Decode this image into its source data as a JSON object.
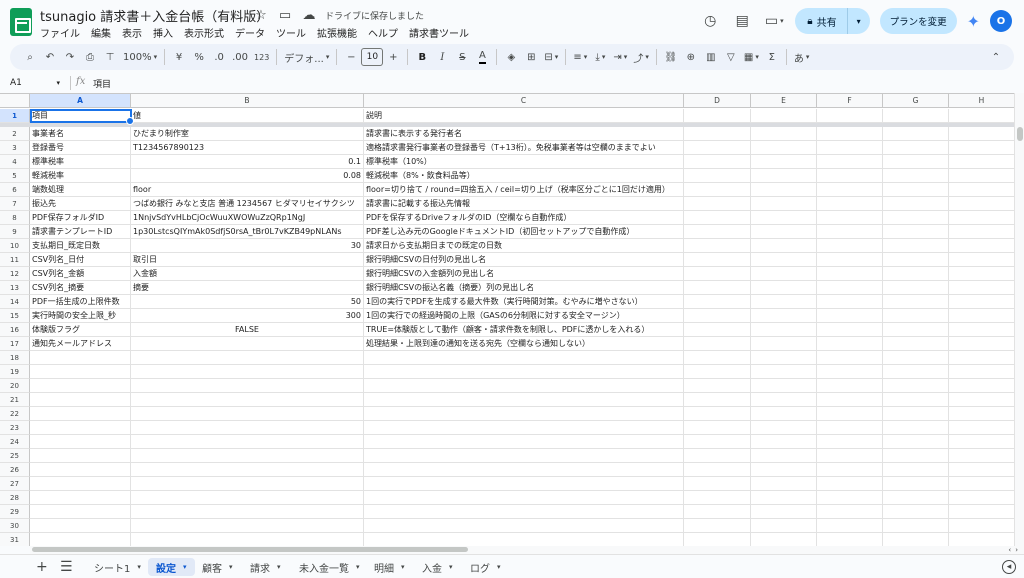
{
  "header": {
    "doc_title": "tsunagio 請求書＋入金台帳（有料版）",
    "saved_status": "ドライブに保存しました",
    "menu": [
      "ファイル",
      "編集",
      "表示",
      "挿入",
      "表示形式",
      "データ",
      "ツール",
      "拡張機能",
      "ヘルプ",
      "請求書ツール"
    ],
    "share_label": "共有",
    "plan_label": "プランを変更",
    "avatar_initial": "O"
  },
  "toolbar": {
    "zoom": "100%",
    "currency": "¥",
    "percent": "%",
    "dec_decrease": ".0",
    "dec_increase": ".00",
    "num_format": "123",
    "font": "デフォ...",
    "font_size": "10",
    "minus": "−",
    "plus": "+",
    "bold": "B",
    "italic": "I",
    "strike": "S",
    "text_color": "A",
    "sigma": "Σ",
    "input_tool": "あ"
  },
  "formula": {
    "cell_ref": "A1",
    "fx": "fx",
    "content": "項目"
  },
  "columns": [
    {
      "id": "A",
      "selected": true
    },
    {
      "id": "B",
      "selected": false
    },
    {
      "id": "C",
      "selected": false
    },
    {
      "id": "D",
      "selected": false
    },
    {
      "id": "E",
      "selected": false
    },
    {
      "id": "F",
      "selected": false
    },
    {
      "id": "G",
      "selected": false
    },
    {
      "id": "H",
      "selected": false
    }
  ],
  "rows": [
    {
      "n": "1",
      "a": "項目",
      "b": "値",
      "c": "説明"
    },
    {
      "n": "2",
      "a": "事業者名",
      "b": "ひだまり制作室",
      "c": "請求書に表示する発行者名"
    },
    {
      "n": "3",
      "a": "登録番号",
      "b": "T1234567890123",
      "c": "適格請求書発行事業者の登録番号（T+13桁）。免税事業者等は空欄のままでよい"
    },
    {
      "n": "4",
      "a": "標準税率",
      "b": "0.1",
      "c": "標準税率（10%）"
    },
    {
      "n": "5",
      "a": "軽減税率",
      "b": "0.08",
      "c": "軽減税率（8%・飲食料品等）"
    },
    {
      "n": "6",
      "a": "端数処理",
      "b": "floor",
      "c": "floor=切り捨て / round=四捨五入 / ceil=切り上げ（税率区分ごとに1回だけ適用）"
    },
    {
      "n": "7",
      "a": "振込先",
      "b": "つばめ銀行 みなと支店 普通 1234567 ヒダマリセイサクシツ",
      "c": "請求書に記載する振込先情報"
    },
    {
      "n": "8",
      "a": "PDF保存フォルダID",
      "b": "1NnjvSdYvHLbCjOcWuuXWOWuZzQRp1NgJ",
      "c": "PDFを保存するDriveフォルダのID（空欄なら自動作成）"
    },
    {
      "n": "9",
      "a": "請求書テンプレートID",
      "b": "1p30LstcsQIYmAk0SdfjS0rsA_tBr0L7vKZB49pNLANs",
      "c": "PDF差し込み元のGoogleドキュメントID（初回セットアップで自動作成）"
    },
    {
      "n": "10",
      "a": "支払期日_既定日数",
      "b": "30",
      "c": "請求日から支払期日までの既定の日数"
    },
    {
      "n": "11",
      "a": "CSV列名_日付",
      "b": "取引日",
      "c": "銀行明細CSVの日付列の見出し名"
    },
    {
      "n": "12",
      "a": "CSV列名_金額",
      "b": "入金額",
      "c": "銀行明細CSVの入金額列の見出し名"
    },
    {
      "n": "13",
      "a": "CSV列名_摘要",
      "b": "摘要",
      "c": "銀行明細CSVの振込名義（摘要）列の見出し名"
    },
    {
      "n": "14",
      "a": "PDF一括生成の上限件数",
      "b": "50",
      "c": "1回の実行でPDFを生成する最大件数（実行時間対策。むやみに増やさない）"
    },
    {
      "n": "15",
      "a": "実行時間の安全上限_秒",
      "b": "300",
      "c": "1回の実行での経過時間の上限（GASの6分制限に対する安全マージン）"
    },
    {
      "n": "16",
      "a": "体験版フラグ",
      "b": "FALSE",
      "c": "TRUE=体験版として動作（顧客・請求件数を制限し、PDFに透かしを入れる）"
    },
    {
      "n": "17",
      "a": "通知先メールアドレス",
      "b": "",
      "c": "処理結果・上限到達の通知を送る宛先（空欄なら通知しない）"
    },
    {
      "n": "18",
      "a": "",
      "b": "",
      "c": ""
    },
    {
      "n": "19",
      "a": "",
      "b": "",
      "c": ""
    },
    {
      "n": "20",
      "a": "",
      "b": "",
      "c": ""
    },
    {
      "n": "21",
      "a": "",
      "b": "",
      "c": ""
    },
    {
      "n": "22",
      "a": "",
      "b": "",
      "c": ""
    },
    {
      "n": "23",
      "a": "",
      "b": "",
      "c": ""
    },
    {
      "n": "24",
      "a": "",
      "b": "",
      "c": ""
    },
    {
      "n": "25",
      "a": "",
      "b": "",
      "c": ""
    },
    {
      "n": "26",
      "a": "",
      "b": "",
      "c": ""
    },
    {
      "n": "27",
      "a": "",
      "b": "",
      "c": ""
    },
    {
      "n": "28",
      "a": "",
      "b": "",
      "c": ""
    },
    {
      "n": "29",
      "a": "",
      "b": "",
      "c": ""
    },
    {
      "n": "30",
      "a": "",
      "b": "",
      "c": ""
    },
    {
      "n": "31",
      "a": "",
      "b": "",
      "c": ""
    },
    {
      "n": "32",
      "a": "",
      "b": "",
      "c": ""
    }
  ],
  "sheet_tabs": [
    {
      "label": "シート1",
      "active": false
    },
    {
      "label": "設定",
      "active": true
    },
    {
      "label": "顧客",
      "active": false
    },
    {
      "label": "請求",
      "active": false
    },
    {
      "label": "未入金一覧",
      "active": false
    },
    {
      "label": "明細",
      "active": false
    },
    {
      "label": "入金",
      "active": false
    },
    {
      "label": "ログ",
      "active": false
    }
  ]
}
